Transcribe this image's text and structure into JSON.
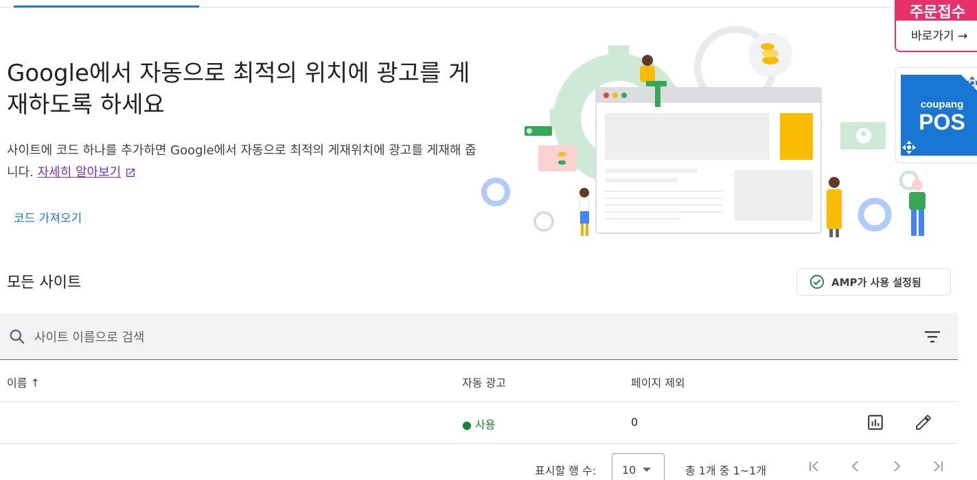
{
  "hero": {
    "title": "Google에서 자동으로 최적의 위치에 광고를 게재하도록 하세요",
    "description": "사이트에 코드 하나를 추가하면 Google에서 자동으로 최적의 게재위치에 광고를 게재해 줍니다.",
    "learn_more": "자세히 알아보기",
    "get_code": "코드 가져오기"
  },
  "ads": {
    "top_heading": "주문접수",
    "top_link": "바로가기 →",
    "coupang_brand": "coupang",
    "coupang_product": "POS"
  },
  "sites": {
    "title": "모든 사이트",
    "amp_chip": "AMP가 사용 설정됨",
    "search_placeholder": "사이트 이름으로 검색",
    "columns": {
      "name": "이름 ↑",
      "auto_ads": "자동 광고",
      "excluded_pages": "페이지 제외"
    },
    "rows": [
      {
        "name": "",
        "auto_ads": "● 사용",
        "excluded_pages": "0"
      }
    ]
  },
  "pagination": {
    "rows_label": "표시할 행 수:",
    "rows_value": "10",
    "range": "총 1개 중 1~1개"
  },
  "colors": {
    "accent": "#1a73e8",
    "link_visited": "#7b2fc9",
    "status_on": "#188038",
    "ad_pink": "#e8306a",
    "coupang_blue": "#1976d2"
  }
}
